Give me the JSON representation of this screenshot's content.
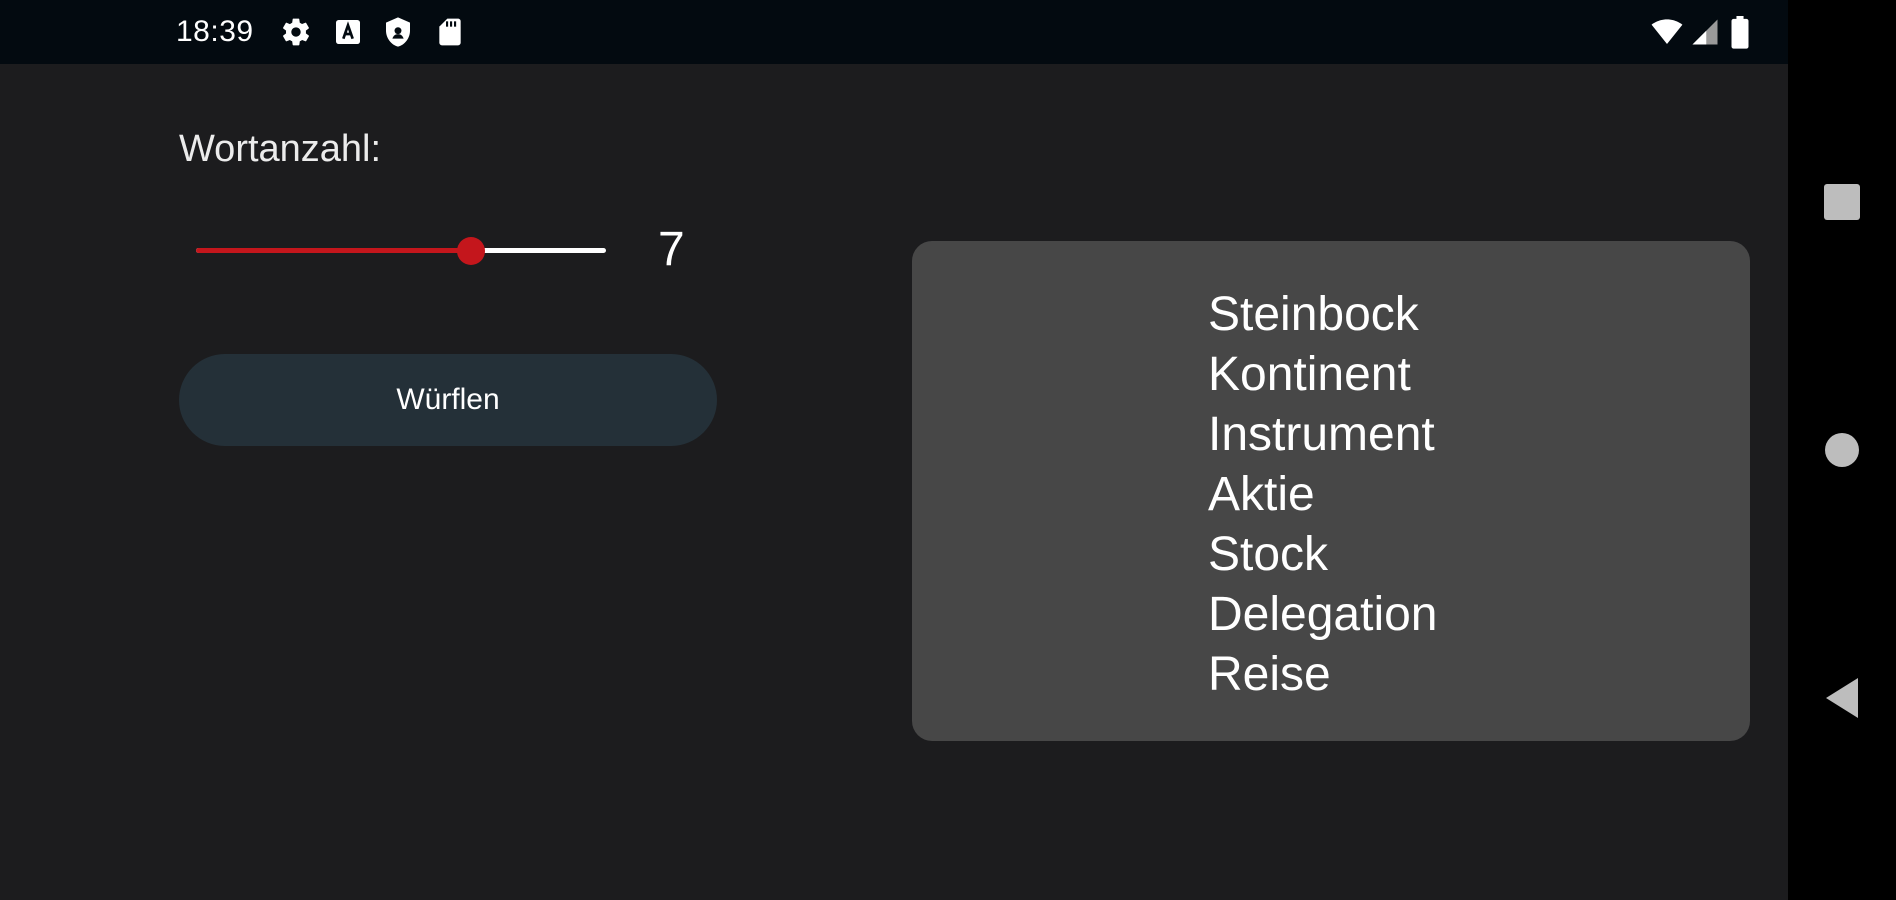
{
  "status_bar": {
    "time": "18:39",
    "icons": [
      "settings-icon",
      "a-notification-icon",
      "shield-icon",
      "sd-card-icon",
      "wifi-icon",
      "signal-icon",
      "battery-icon"
    ]
  },
  "main": {
    "word_count_label": "Wortanzahl:",
    "slider": {
      "value": 7,
      "value_text": "7",
      "fill_fraction": 0.67,
      "active_color": "#c4161c",
      "inactive_color": "#ffffff"
    },
    "roll_button_label": "Würflen",
    "words": [
      "Steinbock",
      "Kontinent",
      "Instrument",
      "Aktie",
      "Stock",
      "Delegation",
      "Reise"
    ]
  },
  "nav_bar": {
    "buttons": [
      "recents-square-icon",
      "home-circle-icon",
      "back-triangle-icon"
    ]
  },
  "colors": {
    "background": "#1c1c1e",
    "panel": "#474747",
    "button": "#243038",
    "accent": "#c4161c"
  }
}
